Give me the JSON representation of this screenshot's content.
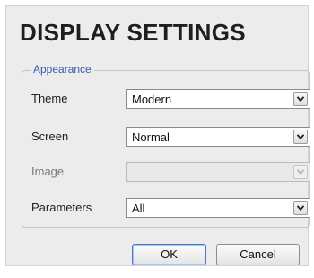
{
  "dialog": {
    "title": "DISPLAY SETTINGS"
  },
  "appearance": {
    "legend": "Appearance",
    "fields": [
      {
        "label": "Theme",
        "value": "Modern",
        "enabled": true
      },
      {
        "label": "Screen",
        "value": "Normal",
        "enabled": true
      },
      {
        "label": "Image",
        "value": "",
        "enabled": false
      },
      {
        "label": "Parameters",
        "value": "All",
        "enabled": true
      }
    ]
  },
  "buttons": {
    "ok_label": "OK",
    "cancel_label": "Cancel"
  },
  "icons": {
    "dropdown": "chevron-down-icon"
  },
  "colors": {
    "legend": "#3a59a8",
    "dialog_background": "#ececec",
    "default_button_border": "#4a78c4"
  }
}
